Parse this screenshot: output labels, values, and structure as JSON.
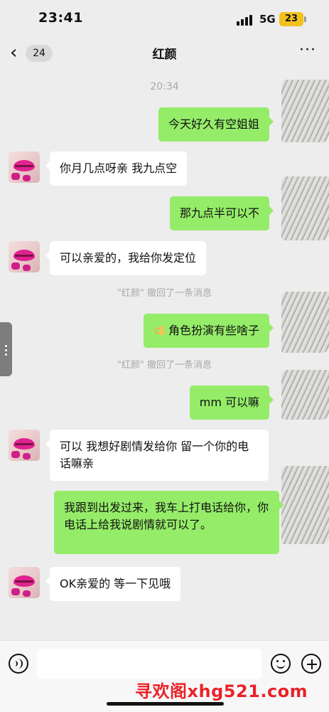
{
  "status": {
    "time": "23:41",
    "network": "5G",
    "battery": "23"
  },
  "nav": {
    "back_count": "24",
    "title": "红颜",
    "more": "···"
  },
  "messages": {
    "timestamp": "20:34",
    "m1": "今天好久有空姐姐",
    "m2": "你月几点呀亲  我九点空",
    "m3": "那九点半可以不",
    "m4": "可以亲爱的，我给你发定位",
    "sys1": "\"红颜\" 撤回了一条消息",
    "m5": "角色扮演有些啥子",
    "sys2": "\"红颜\" 撤回了一条消息",
    "m6": "mm 可以嘛",
    "m7": "可以  我想好剧情发给你  留一个你的电话嘛亲",
    "m8": "我跟到出发过来，我车上打电话给你，你电话上给我说剧情就可以了。",
    "m9": "OK亲爱的  等一下见哦"
  },
  "input": {
    "value": "",
    "placeholder": ""
  },
  "watermark": "寻欢阁xhg521.com",
  "colors": {
    "background": "#ededed",
    "outgoing_bubble": "#95ec69",
    "incoming_bubble": "#ffffff",
    "watermark": "#e8232a"
  }
}
